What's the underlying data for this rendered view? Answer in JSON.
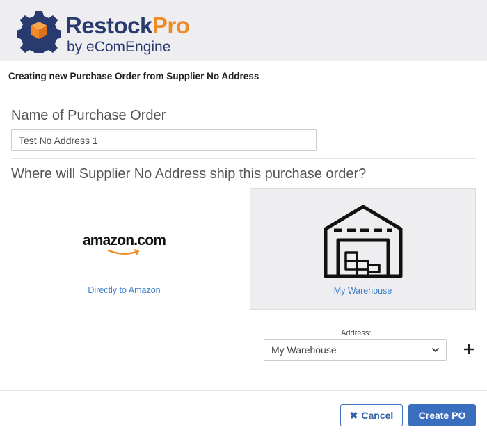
{
  "brand": {
    "name_main": "Restock",
    "name_accent": "Pro",
    "tagline": "by eComEngine",
    "logo_icon": "gear-box-icon",
    "colors": {
      "navy": "#283a6e",
      "orange": "#f08a24"
    }
  },
  "dialog": {
    "subtitle": "Creating new Purchase Order from Supplier No Address",
    "po_name_label": "Name of Purchase Order",
    "po_name_value": "Test No Address 1",
    "ship_question": "Where will Supplier No Address ship this purchase order?",
    "options": [
      {
        "label": "Directly to Amazon",
        "logo_text": "amazon.com",
        "icon": "amazon-logo",
        "selected": false
      },
      {
        "label": "My Warehouse",
        "icon": "warehouse-icon",
        "selected": true
      }
    ],
    "address_label": "Address:",
    "address_value": "My Warehouse",
    "add_icon": "plus-icon",
    "cancel_label": "Cancel",
    "create_label": "Create PO",
    "accent_color": "#3a6fc0"
  }
}
